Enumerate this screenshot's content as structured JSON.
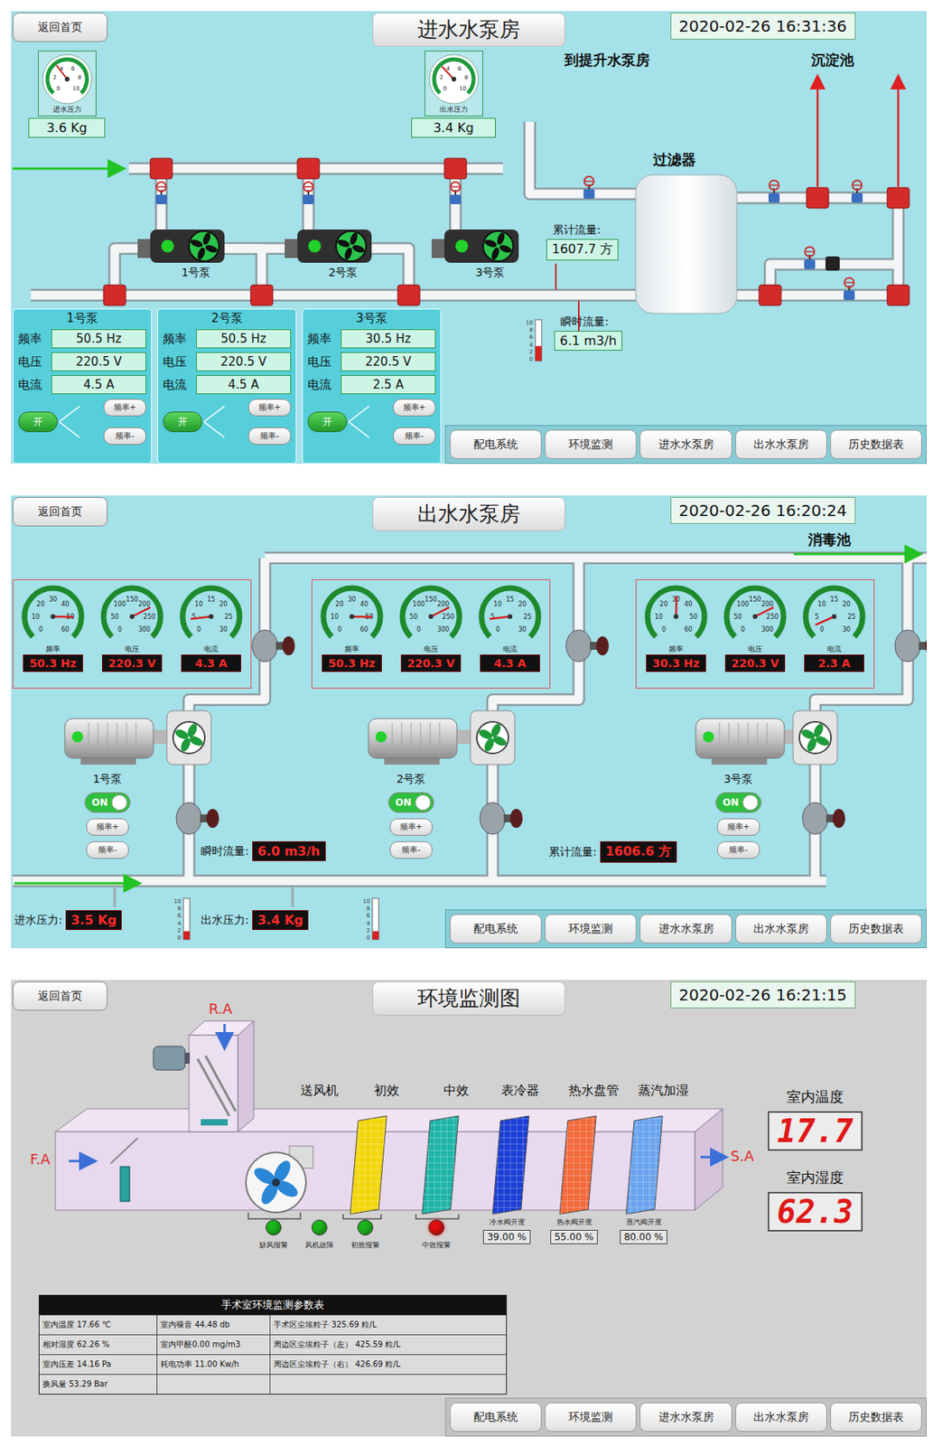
{
  "inlet_room": {
    "back_button": "返回首页",
    "title": "进水水泵房",
    "time": "2020-02-26 16:31:36",
    "to_lift_label": "到提升水泵房",
    "settling_label": "沉淀池",
    "filter_label": "过滤器",
    "gauges": [
      {
        "label": "进水压力",
        "value": "3.6 Kg",
        "level": 0.36,
        "ticks": [
          "0",
          "2",
          "4",
          "6",
          "8",
          "10"
        ]
      },
      {
        "label": "出水压力",
        "value": "3.4 Kg",
        "level": 0.34,
        "ticks": [
          "0",
          "2",
          "4",
          "6",
          "8",
          "10"
        ]
      }
    ],
    "total_flow": {
      "label": "累计流量:",
      "value": "1607.7 方"
    },
    "instant_flow": {
      "label": "瞬时流量:",
      "value": "6.1 m3/h"
    },
    "scale": {
      "ticks": [
        "10",
        "8",
        "6",
        "4",
        "2",
        "0"
      ],
      "level": 0.36
    },
    "pumps": [
      {
        "name": "1号泵",
        "panel_title": "1号泵",
        "running": true,
        "readings": [
          {
            "label": "频率",
            "value": "50.5 Hz"
          },
          {
            "label": "电压",
            "value": "220.5 V"
          },
          {
            "label": "电流",
            "value": "4.5 A"
          }
        ],
        "switch": {
          "label": "开",
          "on": true
        },
        "buttons": [
          "频率+",
          "频率-"
        ]
      },
      {
        "name": "2号泵",
        "panel_title": "2号泵",
        "running": true,
        "readings": [
          {
            "label": "频率",
            "value": "50.5 Hz"
          },
          {
            "label": "电压",
            "value": "220.5 V"
          },
          {
            "label": "电流",
            "value": "4.5 A"
          }
        ],
        "switch": {
          "label": "开",
          "on": true
        },
        "buttons": [
          "频率+",
          "频率-"
        ]
      },
      {
        "name": "3号泵",
        "panel_title": "3号泵",
        "running": true,
        "readings": [
          {
            "label": "频率",
            "value": "30.5 Hz"
          },
          {
            "label": "电压",
            "value": "220.5 V"
          },
          {
            "label": "电流",
            "value": "2.5 A"
          }
        ],
        "switch": {
          "label": "开",
          "on": true
        },
        "buttons": [
          "频率+",
          "频率-"
        ]
      }
    ],
    "nav": [
      {
        "label": "配电系统",
        "selected": false
      },
      {
        "label": "环境监测",
        "selected": false
      },
      {
        "label": "进水水泵房",
        "selected": false
      },
      {
        "label": "出水水泵房",
        "selected": false
      },
      {
        "label": "历史数据表",
        "selected": false
      }
    ]
  },
  "outlet_room": {
    "back_button": "返回首页",
    "title": "出水水泵房",
    "time": "2020-02-26 16:20:24",
    "destination": "消毒池",
    "pumps": [
      {
        "name": "1号泵",
        "running": true,
        "gauges": [
          {
            "label": "频率",
            "value": "50.3 Hz",
            "level": 0.838,
            "ticks": [
              "0",
              "10",
              "20",
              "30",
              "40",
              "50",
              "60"
            ]
          },
          {
            "label": "电压",
            "value": "220.3 V",
            "level": 0.734,
            "ticks": [
              "0",
              "50",
              "100",
              "150",
              "200",
              "250",
              "300"
            ]
          },
          {
            "label": "电流",
            "value": "4.3 A",
            "level": 0.143,
            "ticks": [
              "0",
              "5",
              "10",
              "15",
              "20",
              "25",
              "30"
            ]
          }
        ],
        "toggle": {
          "label": "ON",
          "on": true
        },
        "buttons": [
          "频率+",
          "频率-"
        ]
      },
      {
        "name": "2号泵",
        "running": true,
        "gauges": [
          {
            "label": "频率",
            "value": "50.3 Hz",
            "level": 0.838,
            "ticks": [
              "0",
              "10",
              "20",
              "30",
              "40",
              "50",
              "60"
            ]
          },
          {
            "label": "电压",
            "value": "220.3 V",
            "level": 0.734,
            "ticks": [
              "0",
              "50",
              "100",
              "150",
              "200",
              "250",
              "300"
            ]
          },
          {
            "label": "电流",
            "value": "4.3 A",
            "level": 0.143,
            "ticks": [
              "0",
              "5",
              "10",
              "15",
              "20",
              "25",
              "30"
            ]
          }
        ],
        "toggle": {
          "label": "ON",
          "on": true
        },
        "buttons": [
          "频率+",
          "频率-"
        ]
      },
      {
        "name": "3号泵",
        "running": true,
        "gauges": [
          {
            "label": "频率",
            "value": "30.3 Hz",
            "level": 0.505,
            "ticks": [
              "0",
              "10",
              "20",
              "30",
              "40",
              "50",
              "60"
            ]
          },
          {
            "label": "电压",
            "value": "220.3 V",
            "level": 0.734,
            "ticks": [
              "0",
              "50",
              "100",
              "150",
              "200",
              "250",
              "300"
            ]
          },
          {
            "label": "电流",
            "value": "2.3 A",
            "level": 0.077,
            "ticks": [
              "0",
              "5",
              "10",
              "15",
              "20",
              "25",
              "30"
            ]
          }
        ],
        "toggle": {
          "label": "ON",
          "on": true
        },
        "buttons": [
          "频率+",
          "频率-"
        ]
      }
    ],
    "instant_flow": {
      "label": "瞬时流量:",
      "value": "6.0 m3/h"
    },
    "total_flow": {
      "label": "累计流量:",
      "value": "1606.6 方"
    },
    "pressures": [
      {
        "label": "进水压力:",
        "value": "3.5 Kg",
        "scale": {
          "ticks": [
            "10",
            "8",
            "6",
            "4",
            "2",
            "0"
          ],
          "level": 0.2
        }
      },
      {
        "label": "出水压力:",
        "value": "3.4 Kg",
        "scale": {
          "ticks": [
            "10",
            "8",
            "6",
            "4",
            "2",
            "0"
          ],
          "level": 0.2
        }
      }
    ],
    "nav": [
      {
        "label": "配电系统",
        "selected": false
      },
      {
        "label": "环境监测",
        "selected": false
      },
      {
        "label": "进水水泵房",
        "selected": false
      },
      {
        "label": "出水水泵房",
        "selected": false
      },
      {
        "label": "历史数据表",
        "selected": false
      }
    ]
  },
  "environment": {
    "back_button": "返回首页",
    "title": "环境监测图",
    "time": "2020-02-26 16:21:15",
    "return_air": "R.A",
    "fresh_air": "F.A",
    "supply_air": "S.A",
    "sections": [
      {
        "label": "送风机",
        "kind": "fan"
      },
      {
        "label": "初效",
        "kind": "panel",
        "color": "#f2d60a"
      },
      {
        "label": "中效",
        "kind": "panel",
        "color": "#1fb5a8"
      },
      {
        "label": "表冷器",
        "kind": "panel",
        "color": "#1c3fd6"
      },
      {
        "label": "热水盘管",
        "kind": "panel",
        "color": "#f26a3c"
      },
      {
        "label": "蒸汽加湿",
        "kind": "panel",
        "color": "#6aa4ee"
      }
    ],
    "alarms": [
      {
        "label": "缺风报警",
        "active": false,
        "color": "#1cb41c"
      },
      {
        "label": "风机故障",
        "active": false,
        "color": "#1cb41c"
      },
      {
        "label": "初效报警",
        "active": false,
        "color": "#1cb41c"
      },
      {
        "label": "中效报警",
        "active": true,
        "color": "#e01010"
      }
    ],
    "valves": [
      {
        "label": "冷水阀开度",
        "value": "39.00 %"
      },
      {
        "label": "热水阀开度",
        "value": "55.00 %"
      },
      {
        "label": "蒸汽阀开度",
        "value": "80.00 %"
      }
    ],
    "displays": [
      {
        "label": "室内温度",
        "value": "17.7"
      },
      {
        "label": "室内湿度",
        "value": "62.3"
      }
    ],
    "table": {
      "title": "手术室环境监测参数表",
      "rows": [
        [
          "室内温度 17.66 ℃",
          "室内噪音 44.48 db",
          "手术区尘埃粒子 325.69 粒/L"
        ],
        [
          "相对湿度 62.26 %",
          "室内甲醛0.00 mg/m3",
          "周边区尘埃粒子（左） 425.59 粒/L"
        ],
        [
          "室内压差 14.16 Pa",
          "耗电功率 11.00 Kw/h",
          "周边区尘埃粒子（右） 426.69 粒/L"
        ],
        [
          "换风量 53.29 Bar",
          "",
          ""
        ]
      ]
    },
    "nav": [
      {
        "label": "配电系统",
        "selected": false
      },
      {
        "label": "环境监测",
        "selected": false
      },
      {
        "label": "进水水泵房",
        "selected": false
      },
      {
        "label": "出水水泵房",
        "selected": false
      },
      {
        "label": "历史数据表",
        "selected": false
      }
    ]
  }
}
